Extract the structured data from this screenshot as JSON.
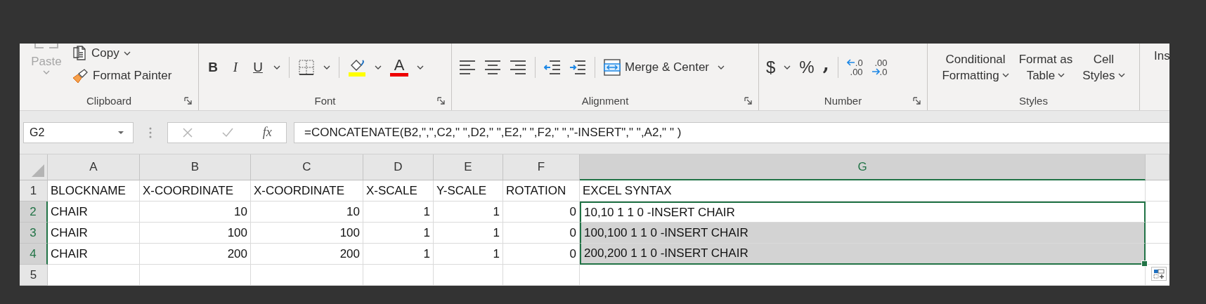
{
  "ribbon": {
    "clipboard": {
      "label": "Clipboard",
      "launcher": true,
      "paste": {
        "label": "Paste",
        "disabled": true
      },
      "copy": "Copy",
      "format_painter": "Format Painter"
    },
    "font": {
      "label": "Font",
      "launcher": true,
      "bold": "B",
      "italic": "I",
      "underline": "U",
      "font_color": "A"
    },
    "alignment": {
      "label": "Alignment",
      "launcher": true,
      "merge": "Merge & Center"
    },
    "number": {
      "label": "Number",
      "launcher": true,
      "currency": "$",
      "percent": "%",
      "comma": ",",
      "increase_decimal": {
        "top": ".0",
        "bottom": ".00"
      },
      "decrease_decimal": {
        "top": ".00",
        "bottom": ".0"
      }
    },
    "styles": {
      "label": "Styles",
      "launcher": false,
      "buttons": [
        {
          "lines": [
            "Conditional",
            "Formatting"
          ]
        },
        {
          "lines": [
            "Format as",
            "Table"
          ]
        },
        {
          "lines": [
            "Cell",
            "Styles"
          ]
        }
      ]
    },
    "cells": {
      "insert": "Ins"
    }
  },
  "formula_bar": {
    "name_box": "G2",
    "function_label": "fx",
    "formula": "=CONCATENATE(B2,\",\",C2,\" \",D2,\" \",E2,\" \",F2,\" \",\"-INSERT\",\" \",A2,\" \" )"
  },
  "grid": {
    "columns": [
      {
        "label": "A",
        "numeric": false,
        "selected": false
      },
      {
        "label": "B",
        "numeric": true,
        "selected": false
      },
      {
        "label": "C",
        "numeric": true,
        "selected": false
      },
      {
        "label": "D",
        "numeric": true,
        "selected": false
      },
      {
        "label": "E",
        "numeric": true,
        "selected": false
      },
      {
        "label": "F",
        "numeric": true,
        "selected": false
      },
      {
        "label": "G",
        "numeric": false,
        "selected": true
      }
    ],
    "rows": [
      {
        "number": "1",
        "selected": false,
        "cells": [
          "BLOCKNAME",
          "X-COORDINATE",
          "X-COORDINATE",
          "X-SCALE",
          "Y-SCALE",
          "ROTATION",
          "EXCEL SYNTAX"
        ]
      },
      {
        "number": "2",
        "selected": true,
        "active": true,
        "cells": [
          "CHAIR",
          "10",
          "10",
          "1",
          "1",
          "0",
          "10,10 1 1 0 -INSERT CHAIR"
        ]
      },
      {
        "number": "3",
        "selected": true,
        "active": false,
        "cells": [
          "CHAIR",
          "100",
          "100",
          "1",
          "1",
          "0",
          "100,100 1 1 0 -INSERT CHAIR"
        ]
      },
      {
        "number": "4",
        "selected": true,
        "active": false,
        "cells": [
          "CHAIR",
          "200",
          "200",
          "1",
          "1",
          "0",
          "200,200 1 1 0 -INSERT CHAIR"
        ]
      },
      {
        "number": "5",
        "selected": false,
        "cells": []
      }
    ]
  }
}
